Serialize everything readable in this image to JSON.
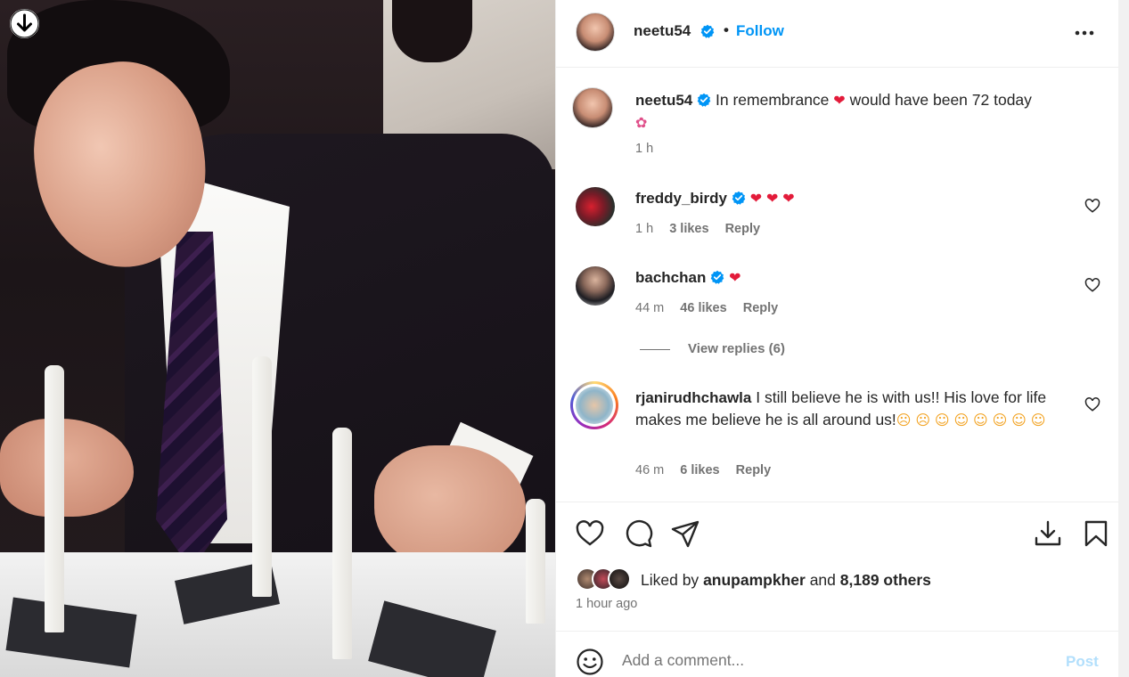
{
  "post": {
    "author": "neetu54",
    "follow_label": "Follow",
    "separator": "•"
  },
  "caption": {
    "username": "neetu54",
    "text_before": "In remembrance",
    "text_after": "would have been 72 today",
    "time": "1 h"
  },
  "comments": [
    {
      "username": "freddy_birdy",
      "text": "",
      "time": "1 h",
      "likes": "3 likes",
      "reply": "Reply"
    },
    {
      "username": "bachchan",
      "text": "",
      "time": "44 m",
      "likes": "46 likes",
      "reply": "Reply",
      "view_replies": "View replies (6)"
    },
    {
      "username": "rjanirudhchawla",
      "text": "I still believe he is with us!! His love for life makes me believe he is all around us!",
      "time": "46 m",
      "likes": "6 likes",
      "reply": "Reply"
    }
  ],
  "likes_summary": {
    "prefix": "Liked by",
    "user": "anupampkher",
    "middle": "and",
    "others": "8,189 others",
    "time_ago": "1 hour ago"
  },
  "add_comment": {
    "placeholder": "Add a comment...",
    "post_label": "Post"
  },
  "icons": {
    "download_media": "arrow-down-circle-icon",
    "more": "more-horizontal-icon",
    "verified": "verified-badge-icon",
    "like": "heart-outline-icon",
    "comment": "speech-bubble-icon",
    "share": "paper-plane-icon",
    "save": "bookmark-icon",
    "download": "download-tray-icon",
    "emoji": "smiley-icon"
  },
  "colors": {
    "accent": "#0095f6",
    "verified": "#0095f6",
    "heart_red": "#e31b3a",
    "muted_text": "#737373",
    "post_disabled": "#b2dffc"
  }
}
